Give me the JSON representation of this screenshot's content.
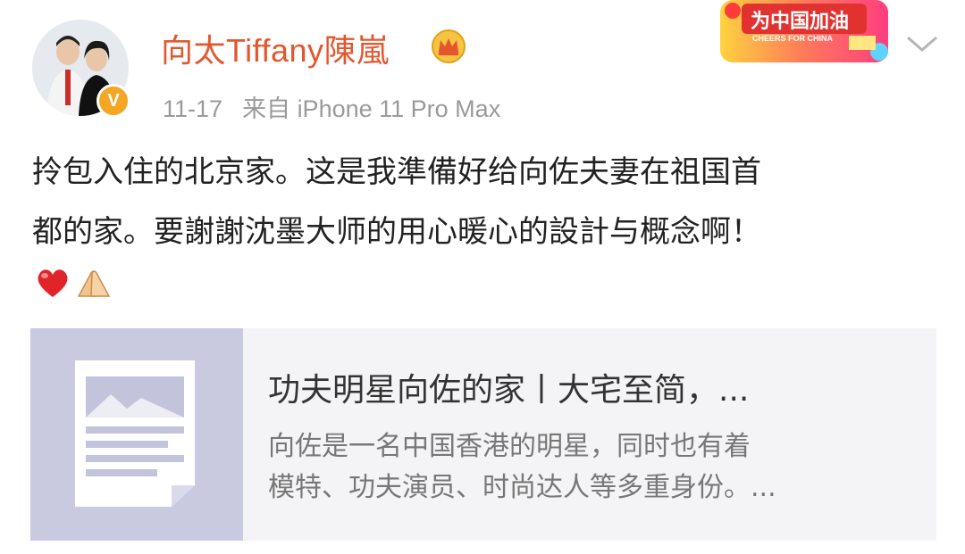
{
  "author": {
    "name": "向太Tiffany陳嵐",
    "verified_badge": "V",
    "crown_icon": "crown-icon"
  },
  "meta": {
    "date": "11-17",
    "source": "来自 iPhone 11 Pro Max"
  },
  "banner": {
    "text": "为中国加油",
    "subtext": "CHEERS FOR CHINA"
  },
  "post": {
    "line1": "拎包入住的北京家。这是我準備好给向佐夫妻在祖国首",
    "line2": "都的家。要謝謝沈墨大师的用心暖心的設計与概念啊！",
    "emojis": [
      "heart-emoji",
      "folded-hands-emoji"
    ]
  },
  "link_card": {
    "title": "功夫明星向佐的家丨大宅至简，...",
    "desc_line1": "向佐是一名中国香港的明星，同时也有着",
    "desc_line2": "模特、功夫演员、时尚达人等多重身份。..."
  },
  "colors": {
    "username": "#e4572e",
    "meta": "#9a9a9a",
    "card_bg": "#f4f4f6",
    "thumb_bg": "#c9c9e0",
    "verified": "#f5a623"
  }
}
